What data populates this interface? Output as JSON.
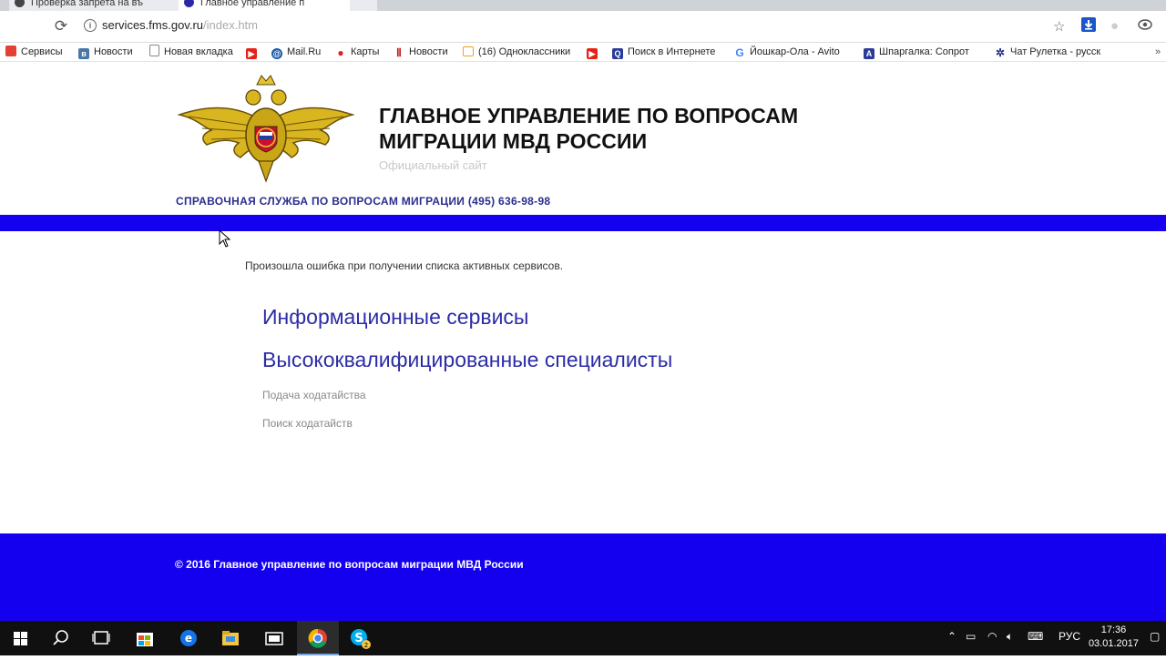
{
  "browser": {
    "tabs": [
      {
        "title": "Проверка запрета на въ",
        "active": false
      },
      {
        "title": "Главное управление п",
        "active": true
      }
    ],
    "url_host": "services.fms.gov.ru",
    "url_path": "/index.htm",
    "bookmarks": [
      {
        "label": "Сервисы",
        "icon": "apps-icon",
        "color": "#e34133"
      },
      {
        "label": "Новости",
        "icon": "vk-icon",
        "color": "#4a76a8"
      },
      {
        "label": "Новая вкладка",
        "icon": "page-icon",
        "color": "#888888"
      },
      {
        "label": "",
        "icon": "youtube-icon",
        "color": "#e62117"
      },
      {
        "label": "Mail.Ru",
        "icon": "mailru-icon",
        "color": "#1b59a6"
      },
      {
        "label": "Карты",
        "icon": "map-pin-icon",
        "color": "#e02020"
      },
      {
        "label": "Новости",
        "icon": "news-icon",
        "color": "#c01818"
      },
      {
        "label": "(16) Одноклассники",
        "icon": "ok-icon",
        "color": "#f0a020"
      },
      {
        "label": "",
        "icon": "youtube-icon",
        "color": "#e62117"
      },
      {
        "label": "Поиск в Интернете",
        "icon": "search-q-icon",
        "color": "#2a3b9a"
      },
      {
        "label": "Йошкар-Ола - Avito",
        "icon": "google-icon",
        "color": "#4285f4"
      },
      {
        "label": "Шпаргалка: Сопрот",
        "icon": "a-icon",
        "color": "#2a3b9a"
      },
      {
        "label": "Чат Рулетка - русск",
        "icon": "chat-icon",
        "color": "#223388"
      }
    ]
  },
  "site": {
    "title_line1": "ГЛАВНОЕ УПРАВЛЕНИЕ ПО ВОПРОСАМ",
    "title_line2": "МИГРАЦИИ МВД РОССИИ",
    "subtitle": "Официальный сайт",
    "helpline": "СПРАВОЧНАЯ СЛУЖБА ПО ВОПРОСАМ МИГРАЦИИ (495) 636-98-98",
    "error_message": "Произошла ошибка при получении списка активных сервисов.",
    "links": {
      "info_services": "Информационные сервисы",
      "highly_qualified": "Высококвалифицированные специалисты",
      "submit_petition": "Подача ходатайства",
      "search_petitions": "Поиск ходатайств"
    },
    "footer": "© 2016 Главное управление по вопросам миграции МВД России",
    "colors": {
      "accent_blue": "#1500f0",
      "link": "#2c2ca8",
      "helpline": "#2a2d8e"
    }
  },
  "taskbar": {
    "language": "РУС",
    "time": "17:36",
    "date": "03.01.2017"
  }
}
